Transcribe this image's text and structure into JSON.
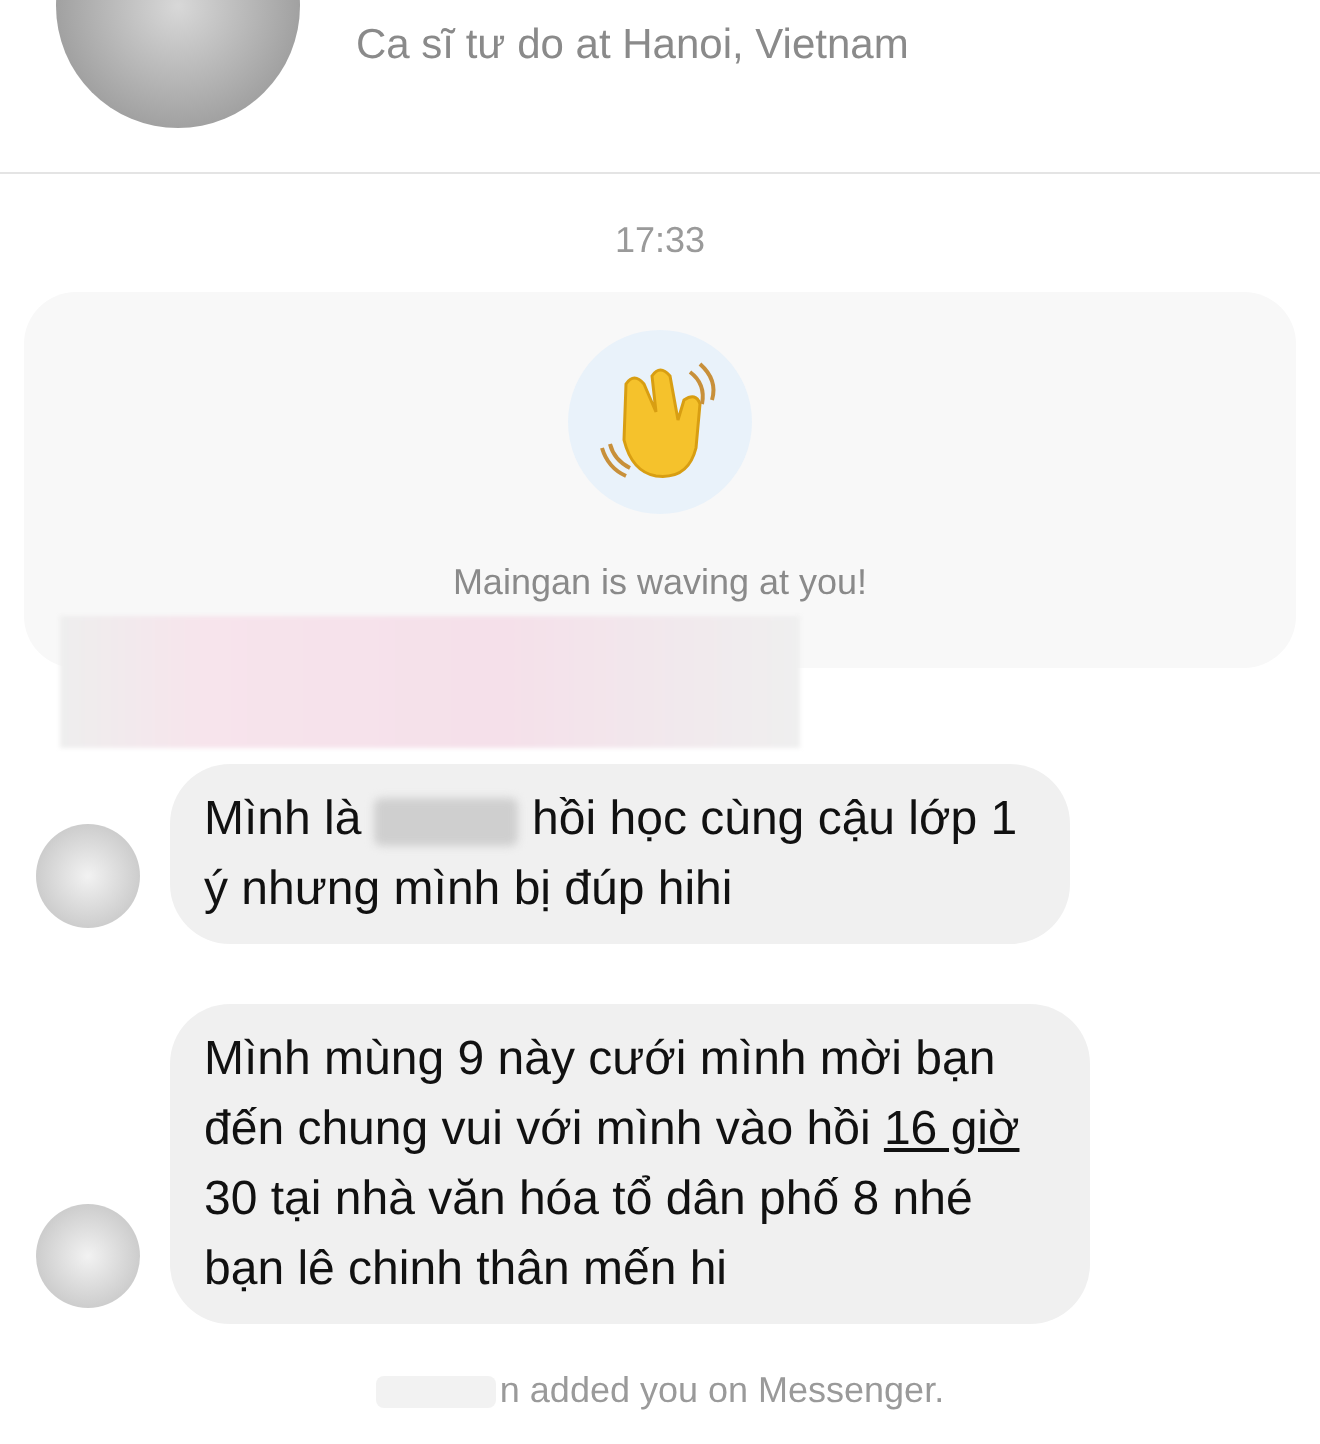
{
  "profile": {
    "subtitle": "Ca sĩ tư do at Hanoi, Vietnam"
  },
  "timestamp": "17:33",
  "wave_card": {
    "message": "Maingan is waving at you!"
  },
  "messages": [
    {
      "parts": [
        {
          "kind": "text",
          "text": "Mình là"
        },
        {
          "kind": "redacted"
        },
        {
          "kind": "text",
          "text": "hồi học cùng cậu lớp 1 ý nhưng mình bị đúp hihi"
        }
      ]
    },
    {
      "parts": [
        {
          "kind": "text",
          "text": "Mình mùng 9 này cưới mình mời bạn đến chung vui với mình vào hồi"
        },
        {
          "kind": "link",
          "text": "16 giờ"
        },
        {
          "kind": "text",
          "text": "30 tại nhà văn hóa tổ dân phố 8 nhé bạn lê chinh thân mến hi"
        }
      ]
    }
  ],
  "footer": "n added you on Messenger."
}
